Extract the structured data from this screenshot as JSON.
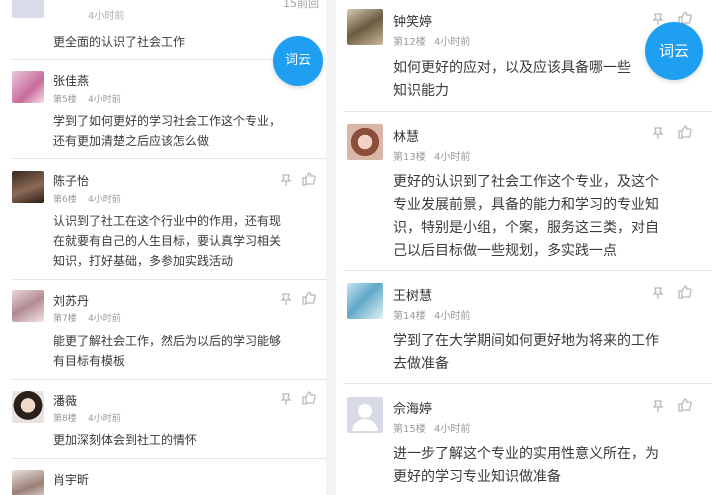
{
  "left": {
    "top_partial": {
      "meta_tail": "4小时前",
      "content": "更全面的认识了社会工作",
      "corner": "15前回"
    },
    "fab_label": "词云",
    "comments": [
      {
        "name": "张佳燕",
        "floor": "第5楼",
        "time": "4小时前",
        "lines": [
          "学到了如何更好的学习社会工作这个专业，",
          "还有更加清楚之后应该怎么做"
        ]
      },
      {
        "name": "陈子怡",
        "floor": "第6楼",
        "time": "4小时前",
        "lines": [
          "认识到了社工在这个行业中的作用，还有现",
          "在就要有自己的人生目标，要认真学习相关",
          "知识，打好基础，多参加实践活动"
        ]
      },
      {
        "name": "刘苏丹",
        "floor": "第7楼",
        "time": "4小时前",
        "lines": [
          "能更了解社会工作，然后为以后的学习能够",
          "有目标有模板"
        ]
      },
      {
        "name": "潘薇",
        "floor": "第8楼",
        "time": "4小时前",
        "lines": [
          "更加深刻体会到社工的情怀"
        ]
      },
      {
        "name": "肖宇昕",
        "floor": "",
        "time": "",
        "lines": []
      }
    ]
  },
  "right": {
    "fab_label": "词云",
    "comments": [
      {
        "name": "钟笑婷",
        "floor": "第12楼",
        "time": "4小时前",
        "lines": [
          "如何更好的应对，以及应该具备哪一些",
          "知识能力"
        ]
      },
      {
        "name": "林慧",
        "floor": "第13楼",
        "time": "4小时前",
        "lines": [
          "更好的认识到了社会工作这个专业，及这个",
          "专业发展前景，具备的能力和学习的专业知",
          "识，特别是小组，个案，服务这三类，对自",
          "己以后目标做一些规划，多实践一点"
        ]
      },
      {
        "name": "王树慧",
        "floor": "第14楼",
        "time": "4小时前",
        "lines": [
          "学到了在大学期间如何更好地为将来的工作",
          "去做准备"
        ]
      },
      {
        "name": "佘海婷",
        "floor": "第15楼",
        "time": "4小时前",
        "lines": [
          "进一步了解这个专业的实用性意义所在，为",
          "更好的学习专业知识做准备"
        ]
      }
    ]
  },
  "colors": {
    "fab": "#1e9ff2",
    "meta": "#9a9a9a",
    "text": "#3a3a3a",
    "divider": "#e6e6e6"
  },
  "icons": {
    "pin": "pin-icon",
    "like": "thumbs-up-icon"
  }
}
